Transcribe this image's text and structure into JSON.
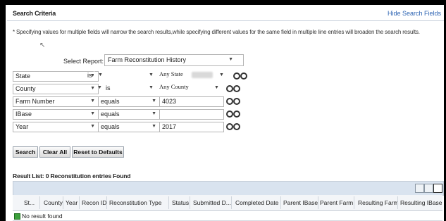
{
  "header": {
    "title": "Search Criteria",
    "hide_link": "Hide Search Fields"
  },
  "note": "* Specifying values for multiple fields will narrow the search results,while specifying different values for the same field in multiple line entries will broaden the search results.",
  "select_report": {
    "label": "Select Report:",
    "value": "Farm Reconstitution History"
  },
  "criteria": [
    {
      "field": "State",
      "operator": "is",
      "value": "Any State"
    },
    {
      "field": "County",
      "operator": "is",
      "value": "Any County"
    },
    {
      "field": "Farm Number",
      "operator": "equals",
      "value": "4023"
    },
    {
      "field": "IBase",
      "operator": "equals",
      "value": ""
    },
    {
      "field": "Year",
      "operator": "equals",
      "value": "2017"
    }
  ],
  "buttons": {
    "search": "Search",
    "clear_all": "Clear All",
    "reset": "Reset to Defaults"
  },
  "result_label": "Result List: 0 Reconstitution entries Found",
  "columns": [
    "St...",
    "County",
    "Year",
    "Recon ID",
    "Reconstitution Type",
    "Status",
    "Submitted D...",
    "Completed Date",
    "Parent IBase",
    "Parent Farm",
    "Resulting Farm",
    "Resulting IBase"
  ],
  "no_result": "No result found"
}
